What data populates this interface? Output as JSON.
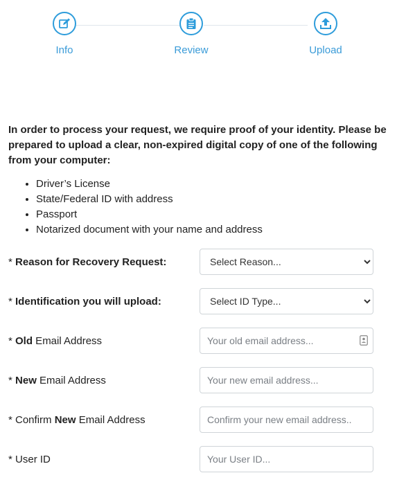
{
  "steps": [
    {
      "label": "Info",
      "icon": "edit-icon"
    },
    {
      "label": "Review",
      "icon": "clipboard-icon"
    },
    {
      "label": "Upload",
      "icon": "upload-icon"
    }
  ],
  "accent_color": "#2d9cdb",
  "intro_text": "In order to process your request, we require proof of your identity. Please be prepared to upload a clear, non-expired digital copy of one of the following from your computer:",
  "proof_list": [
    "Driver’s License",
    "State/Federal ID with address",
    "Passport",
    "Notarized document with your name and address"
  ],
  "form": {
    "reason": {
      "prefix": "* ",
      "label": "Reason for Recovery Request:",
      "selected": "Select Reason..."
    },
    "id_type": {
      "prefix": "* ",
      "label": "Identification you will upload:",
      "selected": "Select ID Type..."
    },
    "old_email": {
      "prefix": "* ",
      "label_bold": "Old",
      "label_rest": " Email Address",
      "placeholder": "Your old email address..."
    },
    "new_email": {
      "prefix": "* ",
      "label_bold": "New",
      "label_rest": " Email Address",
      "placeholder": "Your new email address..."
    },
    "confirm_email": {
      "prefix": "* Confirm ",
      "label_bold": "New",
      "label_rest": " Email Address",
      "placeholder": "Confirm your new email address..."
    },
    "user_id": {
      "prefix": "* ",
      "label": "User ID",
      "placeholder": "Your User ID..."
    }
  }
}
